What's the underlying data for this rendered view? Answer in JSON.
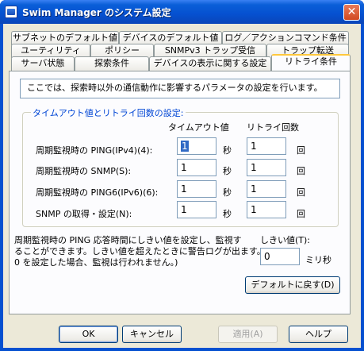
{
  "window": {
    "title": "Swim Manager のシステム設定",
    "close_glyph": "✕"
  },
  "tabs": {
    "row1": [
      "サブネットのデフォルト値",
      "デバイスのデフォルト値",
      "ログ／アクションコマンド条件"
    ],
    "row2": [
      "ユーティリティ",
      "ポリシー",
      "SNMPv3 トラップ受信",
      "トラップ転送"
    ],
    "row3": [
      "サーバ状態",
      "探索条件",
      "デバイスの表示に関する設定",
      "リトライ条件"
    ],
    "active": "リトライ条件"
  },
  "info": "ここでは、探索時以外の通信動作に影響するパラメータの設定を行います。",
  "group": {
    "title": "タイムアウト値とリトライ回数の設定:",
    "col_timeout": "タイムアウト値",
    "col_retry": "リトライ回数",
    "rows": [
      {
        "label": "周期監視時の PING(IPv4)(4):",
        "timeout": "1",
        "unit_timeout": "秒",
        "retry": "1",
        "unit_retry": "回"
      },
      {
        "label": "周期監視時の SNMP(S):",
        "timeout": "1",
        "unit_timeout": "秒",
        "retry": "1",
        "unit_retry": "回"
      },
      {
        "label": "周期監視時の PING6(IPv6)(6):",
        "timeout": "1",
        "unit_timeout": "秒",
        "retry": "1",
        "unit_retry": "回"
      },
      {
        "label": "SNMP の取得・設定(N):",
        "timeout": "1",
        "unit_timeout": "秒",
        "retry": "1",
        "unit_retry": "回"
      }
    ]
  },
  "threshold": {
    "description_line1": "周期監視時の PING 応答時間にしきい値を設定し、監視す",
    "description_line2": "ることができます。しきい値を超えたときに警告ログが出ます。(",
    "description_line3": "0 を設定した場合、監視は行われません。)",
    "label": "しきい値(T):",
    "value": "0",
    "unit": "ミリ秒"
  },
  "buttons": {
    "default": "デフォルトに戻す(D)",
    "ok": "OK",
    "cancel": "キャンセル",
    "apply": "適用(A)",
    "help": "ヘルプ"
  }
}
